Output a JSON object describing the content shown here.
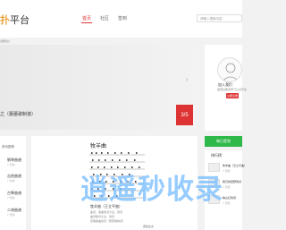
{
  "header": {
    "logo": {
      "text_pre": "",
      "text_accent": "扑",
      "text_post": "平台"
    },
    "nav": [
      {
        "label": "首页",
        "active": true
      },
      {
        "label": "社区",
        "active": false
      },
      {
        "label": "签到",
        "active": false
      }
    ],
    "search_placeholder": "请输入搜索内容"
  },
  "subheader": {
    "label": "(通知栏)"
  },
  "banner": {
    "title": "之（蕾蕾歌制谱）",
    "counter": "3/5",
    "next_arrow": "›"
  },
  "sidebar": {
    "join_title": "加入我们",
    "join_sub": "发现好歌谱学习认识乐友",
    "join_button": "立即注册"
  },
  "checkin": {
    "label": "每日签到"
  },
  "left_panel": {
    "title": "资讯推荐",
    "items": [
      {
        "label": "钢琴曲谱",
        "date": "7 天前"
      },
      {
        "label": "吉他曲谱",
        "date": "7 天前"
      },
      {
        "label": "古筝曲谱",
        "date": "7 天前"
      },
      {
        "label": "二胡曲谱",
        "date": "7 天前"
      }
    ]
  },
  "article": {
    "score_title": "牧羊曲",
    "caption": "牧羊曲（王立平曲）",
    "desc_lines": [
      "曲谱，歌曲简谱大全，简谱",
      "曲谱歌词大全，简谱",
      "原唱歌曲简谱（蕾蕾歌制谱）"
    ],
    "footer": "阅读全文"
  },
  "ranking": {
    "title": "排行榜",
    "items": [
      {
        "label": "牧羊曲（王立平曲）",
        "date": "7 天前"
      },
      {
        "label": "我们的田野简谱",
        "date": "7 天前"
      },
      {
        "label": "映山红简谱",
        "date": "7 天前"
      }
    ]
  },
  "watermark": {
    "text": "逍遥秒收录"
  },
  "colors": {
    "accent": "#dd3333",
    "logo_accent": "#e8a33a",
    "checkin": "#2fb84a",
    "watermark": "#78beff"
  }
}
